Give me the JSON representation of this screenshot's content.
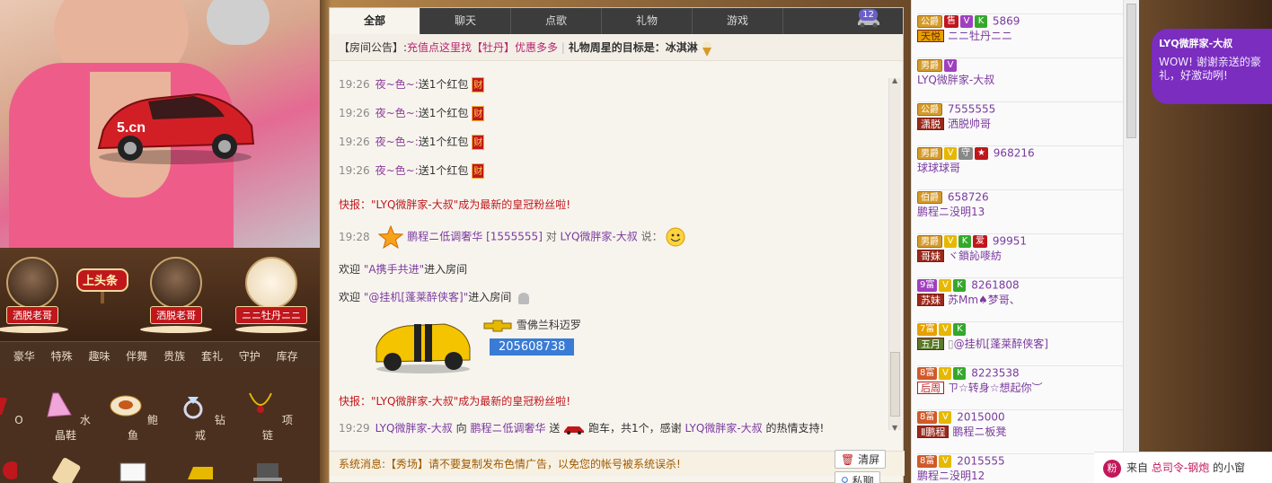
{
  "left": {
    "gifters": [
      {
        "name": "洒脱老哥"
      },
      {
        "name": "洒脱老哥"
      },
      {
        "name": "ニニ牡丹ニニ"
      }
    ],
    "headline_label": "上头条",
    "gift_tabs": [
      "豪华",
      "特殊",
      "趣味",
      "伴舞",
      "贵族",
      "套礼",
      "守护",
      "库存"
    ],
    "gifts": [
      {
        "label": "O",
        "icon": "heel-icon"
      },
      {
        "label": "水晶鞋",
        "icon": "crystal-shoe-icon"
      },
      {
        "label": "鲍鱼",
        "icon": "abalone-icon"
      },
      {
        "label": "钻戒",
        "icon": "diamond-ring-icon"
      },
      {
        "label": "项链",
        "icon": "necklace-icon"
      }
    ]
  },
  "chat": {
    "tabs": [
      "全部",
      "聊天",
      "点歌",
      "礼物",
      "游戏"
    ],
    "car_count": "12",
    "notice": {
      "prefix": "【房间公告】:",
      "link": "充值点这里找【牡丹】优惠多多",
      "sep": "|",
      "text": "礼物周星的目标是：冰淇淋"
    },
    "messages": [
      {
        "time": "19:26",
        "user": "夜~色~:",
        "text": "送1个红包",
        "badge": "财"
      },
      {
        "time": "19:26",
        "user": "夜~色~:",
        "text": "送1个红包",
        "badge": "财"
      },
      {
        "time": "19:26",
        "user": "夜~色~:",
        "text": "送1个红包",
        "badge": "财"
      },
      {
        "time": "19:26",
        "user": "夜~色~:",
        "text": "送1个红包",
        "badge": "财"
      }
    ],
    "flash1": "快报：\"LYQ微胖家-大叔\"成为最新的皇冠粉丝啦!",
    "say": {
      "time": "19:28",
      "from": "鹏程ニ低调奢华 [1555555]",
      "mid": "对",
      "to": "LYQ微胖家-大叔",
      "end": "说："
    },
    "welcome1": {
      "pre": "欢迎",
      "name": "\"A携手共进\"",
      "post": "进入房间"
    },
    "welcome2": {
      "pre": "欢迎",
      "name": "\"@挂机[蓬莱醉侠客]\"",
      "post": "进入房间"
    },
    "car_entry": {
      "model": "雪佛兰科迈罗",
      "id": "205608738"
    },
    "flash2": "快报：\"LYQ微胖家-大叔\"成为最新的皇冠粉丝啦!",
    "gift_msg": {
      "time": "19:29",
      "from": "LYQ微胖家-大叔",
      "to_word": "向",
      "to": "鹏程ニ低调奢华",
      "send": "送",
      "item": "跑车，共1个，感谢",
      "thanker": "LYQ微胖家-大叔",
      "end": "的热情支持!"
    },
    "system": "系统消息:【秀场】请不要复制发布色情广告，以免您的帐号被系统误杀!",
    "clear_btn": "清屏",
    "private_btn": "私聊"
  },
  "users": [
    {
      "badges": [
        "公爵",
        "售",
        "V",
        "K"
      ],
      "id": "5869",
      "fan": "天悦",
      "name": "ニニ牡丹ニニ"
    },
    {
      "badges": [
        "男爵",
        "V"
      ],
      "id": "",
      "fan": "",
      "name": "LYQ微胖家-大叔"
    },
    {
      "badges": [
        "公爵"
      ],
      "id": "7555555",
      "fan": "潇脱",
      "name": "洒脱帅哥"
    },
    {
      "badges": [
        "男爵",
        "V",
        "守",
        "★"
      ],
      "id": "968216",
      "fan": "",
      "name": "球球球哥"
    },
    {
      "badges": [
        "伯爵"
      ],
      "id": "658726",
      "fan": "",
      "name": "鹏程ニ没明13"
    },
    {
      "badges": [
        "男爵",
        "V",
        "K",
        "爱"
      ],
      "id": "99951",
      "fan": "哥妹",
      "name": "ヾ鎖訫嘜紡"
    },
    {
      "badges": [
        "9富",
        "V",
        "K"
      ],
      "id": "8261808",
      "fan": "苏妹",
      "name": "苏Mm♠梦哥、"
    },
    {
      "badges": [
        "7富",
        "V",
        "K"
      ],
      "id": "",
      "fan": "五月",
      "name": "@挂机[蓬莱醉侠客]"
    },
    {
      "badges": [
        "8富",
        "V",
        "K"
      ],
      "id": "8223538",
      "fan": "后周",
      "name": "ㄗ☆转身☆想起你︶"
    },
    {
      "badges": [
        "8富",
        "V"
      ],
      "id": "2015000",
      "fan": "Ⅱ鹏程",
      "name": "鹏程ニ板凳"
    },
    {
      "badges": [
        "8富",
        "V"
      ],
      "id": "2015555",
      "fan": "",
      "name": "鹏程ニ没明12"
    }
  ],
  "bubble": {
    "name": "LYQ微胖家-大叔",
    "msg": "WOW! 谢谢亲送的豪礼，好激动咧!"
  },
  "fanbox": {
    "icon": "粉",
    "pre": "来自",
    "who": "总司令-钢炮",
    "post": "的小窗"
  },
  "colors": {
    "accent": "#7b3a9f",
    "red": "#c0171c",
    "tab_bar": "#3c3c3c"
  }
}
